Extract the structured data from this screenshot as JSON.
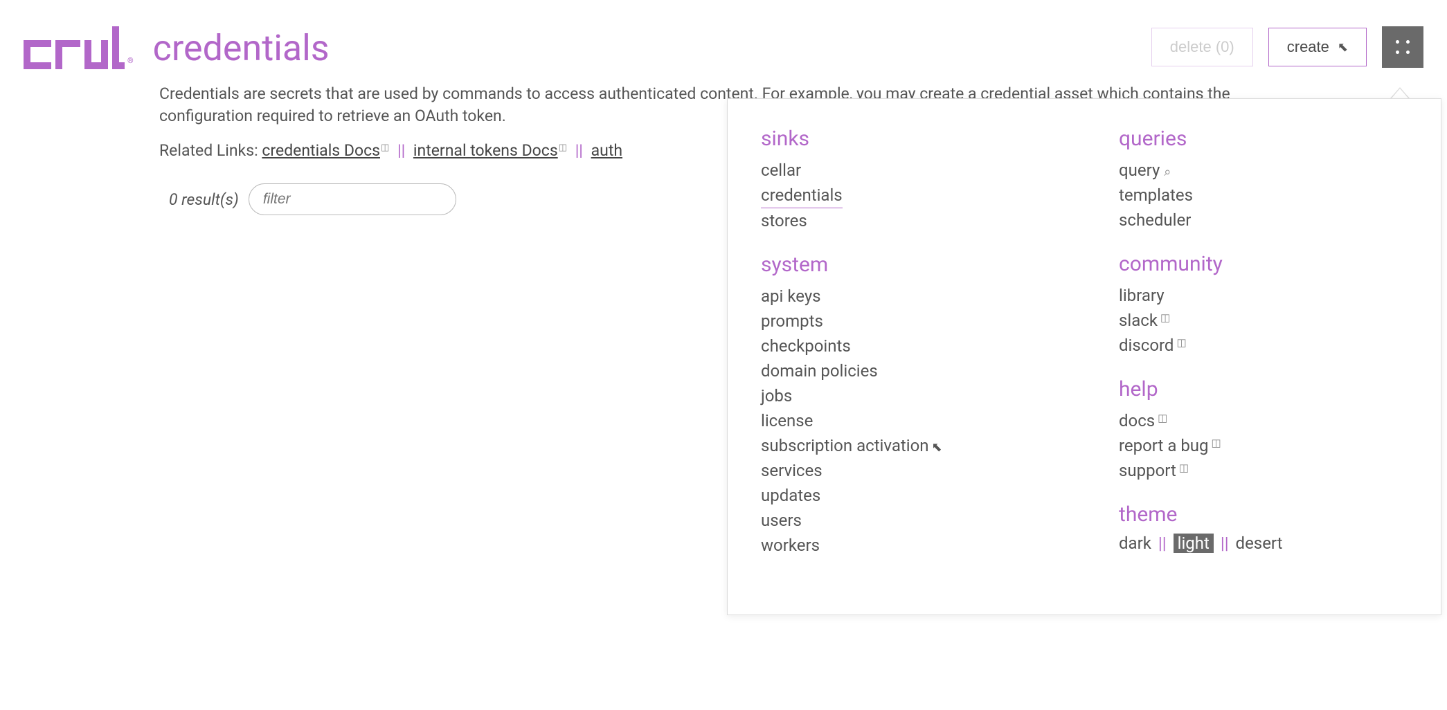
{
  "header": {
    "logo_reg": "®",
    "title": "credentials",
    "delete_label": "delete (0)",
    "create_label": "create"
  },
  "content": {
    "description": "Credentials are secrets that are used by commands to access authenticated content. For example, you may create a credential asset which contains the configuration required to retrieve an OAuth token.",
    "related_prefix": "Related Links:",
    "links": [
      {
        "label": "credentials Docs",
        "external": true
      },
      {
        "label": "internal tokens Docs",
        "external": true
      },
      {
        "label": "auth",
        "external": false
      }
    ],
    "link_sep": "||",
    "result_count": "0 result(s)",
    "filter_placeholder": "filter"
  },
  "dropdown": {
    "col1": [
      {
        "heading": "sinks",
        "items": [
          {
            "label": "cellar"
          },
          {
            "label": "credentials",
            "active": true
          },
          {
            "label": "stores"
          }
        ]
      },
      {
        "heading": "system",
        "items": [
          {
            "label": "api keys"
          },
          {
            "label": "prompts"
          },
          {
            "label": "checkpoints"
          },
          {
            "label": "domain policies"
          },
          {
            "label": "jobs"
          },
          {
            "label": "license"
          },
          {
            "label": "subscription activation",
            "nw": true
          },
          {
            "label": "services"
          },
          {
            "label": "updates"
          },
          {
            "label": "users"
          },
          {
            "label": "workers"
          }
        ]
      }
    ],
    "col2": [
      {
        "heading": "queries",
        "items": [
          {
            "label": "query",
            "search": true
          },
          {
            "label": "templates"
          },
          {
            "label": "scheduler"
          }
        ]
      },
      {
        "heading": "community",
        "items": [
          {
            "label": "library"
          },
          {
            "label": "slack",
            "external": true
          },
          {
            "label": "discord",
            "external": true
          }
        ]
      },
      {
        "heading": "help",
        "items": [
          {
            "label": "docs",
            "external": true
          },
          {
            "label": "report a bug",
            "external": true
          },
          {
            "label": "support",
            "external": true
          }
        ]
      },
      {
        "heading": "theme",
        "theme": true,
        "options": [
          "dark",
          "light",
          "desert"
        ],
        "selected": "light",
        "sep": "||"
      }
    ]
  }
}
